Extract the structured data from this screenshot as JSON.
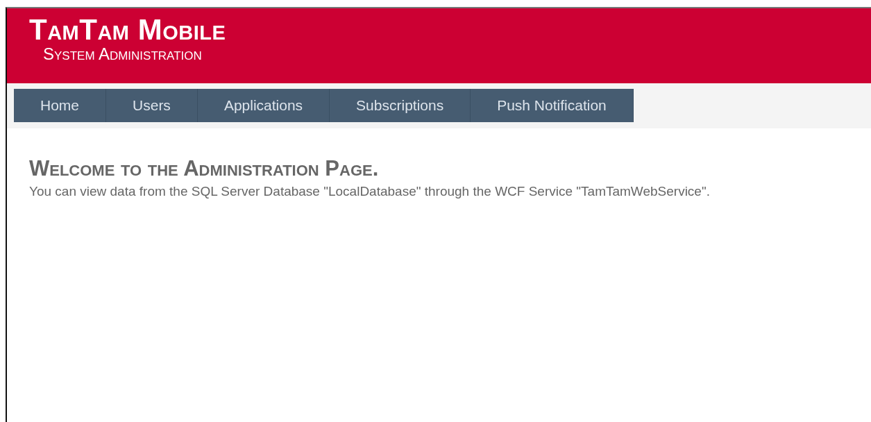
{
  "header": {
    "title": "TamTam Mobile",
    "subtitle": "System Administration"
  },
  "nav": [
    {
      "label": "Home"
    },
    {
      "label": "Users"
    },
    {
      "label": "Applications"
    },
    {
      "label": "Subscriptions"
    },
    {
      "label": "Push Notification"
    }
  ],
  "main": {
    "heading": "Welcome to the Administration Page.",
    "text": "You can view data from the SQL Server Database \"LocalDatabase\" through the WCF Service \"TamTamWebService\"."
  }
}
